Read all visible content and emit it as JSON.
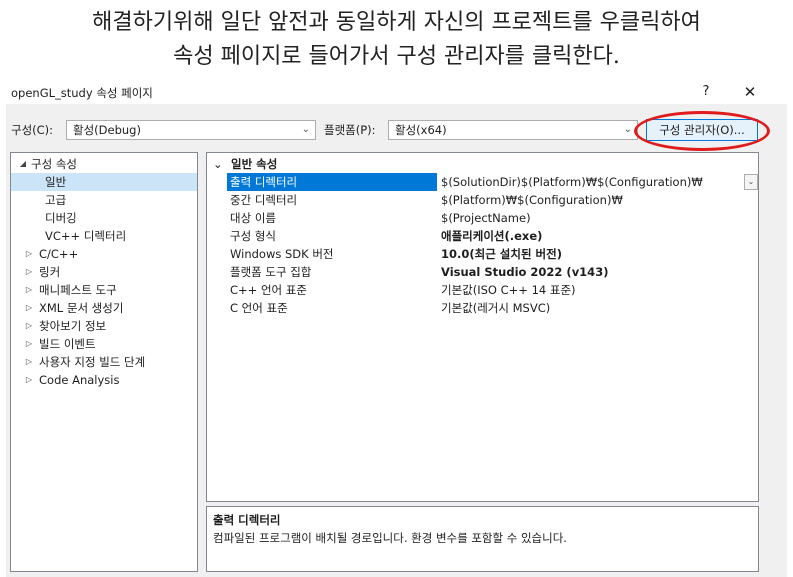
{
  "caption": {
    "line1": "해결하기위해 일단 앞전과 동일하게 자신의 프로젝트를 우클릭하여",
    "line2": "속성 페이지로 들어가서 구성 관리자를 클릭한다."
  },
  "window": {
    "title": "openGL_study 속성 페이지",
    "help": "?",
    "close": "✕"
  },
  "toolbar": {
    "config_label": "구성(C):",
    "config_value": "활성(Debug)",
    "platform_label": "플랫폼(P):",
    "platform_value": "활성(x64)",
    "config_manager": "구성 관리자(O)...",
    "arrow": "⌄"
  },
  "tree": {
    "items": [
      {
        "label": "구성 속성",
        "expander": "◢"
      },
      {
        "label": "일반"
      },
      {
        "label": "고급"
      },
      {
        "label": "디버깅"
      },
      {
        "label": "VC++ 디렉터리"
      },
      {
        "label": "C/C++",
        "expander": "▷"
      },
      {
        "label": "링커",
        "expander": "▷"
      },
      {
        "label": "매니페스트 도구",
        "expander": "▷"
      },
      {
        "label": "XML 문서 생성기",
        "expander": "▷"
      },
      {
        "label": "찾아보기 정보",
        "expander": "▷"
      },
      {
        "label": "빌드 이벤트",
        "expander": "▷"
      },
      {
        "label": "사용자 지정 빌드 단계",
        "expander": "▷"
      },
      {
        "label": "Code Analysis",
        "expander": "▷"
      }
    ]
  },
  "grid": {
    "section": "일반 속성",
    "section_expander": "⌄",
    "rows": [
      {
        "name": "출력 디렉터리",
        "value": "$(SolutionDir)$(Platform)₩$(Configuration)₩"
      },
      {
        "name": "중간 디렉터리",
        "value": "$(Platform)₩$(Configuration)₩"
      },
      {
        "name": "대상 이름",
        "value": "$(ProjectName)"
      },
      {
        "name": "구성 형식",
        "value": "애플리케이션(.exe)"
      },
      {
        "name": "Windows SDK 버전",
        "value": "10.0(최근 설치된 버전)"
      },
      {
        "name": "플랫폼 도구 집합",
        "value": "Visual Studio 2022 (v143)"
      },
      {
        "name": "C++ 언어 표준",
        "value": "기본값(ISO C++ 14 표준)"
      },
      {
        "name": "C 언어 표준",
        "value": "기본값(레거시 MSVC)"
      }
    ],
    "dropdown_arrow": "⌄"
  },
  "description": {
    "title": "출력 디렉터리",
    "text": "컴파일된 프로그램이 배치될 경로입니다. 환경 변수를 포함할 수 있습니다."
  }
}
